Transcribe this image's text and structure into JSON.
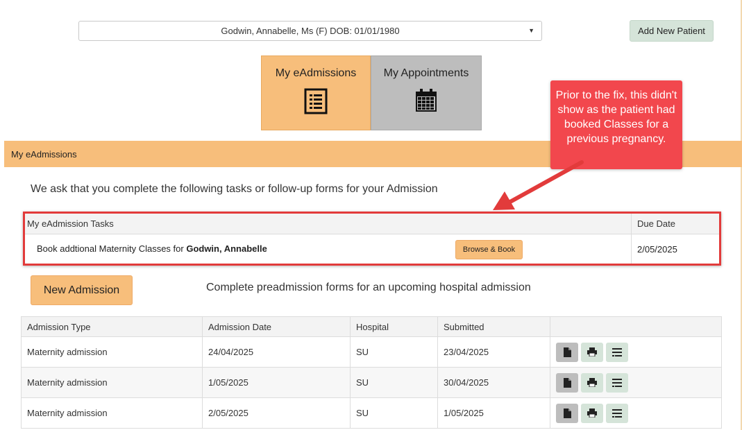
{
  "patient_select": {
    "value": "Godwin, Annabelle, Ms (F) DOB: 01/01/1980",
    "caret": "▼"
  },
  "add_patient_label": "Add New Patient",
  "tiles": [
    {
      "label": "My eAdmissions",
      "icon": "list-form-icon",
      "active": true
    },
    {
      "label": "My Appointments",
      "icon": "calendar-icon",
      "active": false
    }
  ],
  "section_title": "My eAdmissions",
  "intro_text": "We ask that you complete the following tasks or follow-up forms for your Admission",
  "tasks": {
    "header_task": "My eAdmission Tasks",
    "header_due": "Due Date",
    "row": {
      "text_prefix": "Book addtional Maternity Classes for ",
      "patient_name": "Godwin, Annabelle",
      "button_label": "Browse & Book",
      "due_date": "2/05/2025"
    }
  },
  "callout_text": "Prior to the fix, this didn't show as the patient had booked Classes for a previous pregnancy.",
  "new_admission": {
    "button_label": "New Admission",
    "description": "Complete preadmission forms for an upcoming hospital admission"
  },
  "admissions": {
    "columns": [
      "Admission Type",
      "Admission Date",
      "Hospital",
      "Submitted",
      ""
    ],
    "rows": [
      {
        "type": "Maternity admission",
        "date": "24/04/2025",
        "hospital": "SU",
        "submitted": "23/04/2025"
      },
      {
        "type": "Maternity admission",
        "date": "1/05/2025",
        "hospital": "SU",
        "submitted": "30/04/2025"
      },
      {
        "type": "Maternity admission",
        "date": "2/05/2025",
        "hospital": "SU",
        "submitted": "1/05/2025"
      }
    ]
  },
  "colors": {
    "accent_orange": "#f7be7b",
    "callout_red": "#f2474d",
    "frame_red": "#e23b3b",
    "action_green": "#d5e4d9",
    "action_grey": "#bdbdbd"
  }
}
